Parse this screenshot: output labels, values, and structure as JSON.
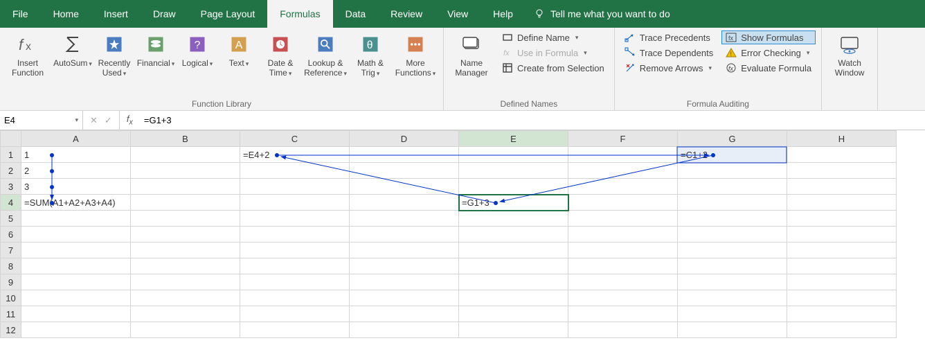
{
  "menu": {
    "tabs": [
      "File",
      "Home",
      "Insert",
      "Draw",
      "Page Layout",
      "Formulas",
      "Data",
      "Review",
      "View",
      "Help"
    ],
    "active": "Formulas",
    "tell_me": "Tell me what you want to do"
  },
  "ribbon": {
    "group_labels": {
      "funclib": "Function Library",
      "defnames": "Defined Names",
      "auditing": "Formula Auditing"
    },
    "insert_function": "Insert Function",
    "autosum": "AutoSum",
    "recently_used": "Recently Used",
    "financial": "Financial",
    "logical": "Logical",
    "text": "Text",
    "date_time": "Date & Time",
    "lookup_ref": "Lookup & Reference",
    "math_trig": "Math & Trig",
    "more_func": "More Functions",
    "name_manager": "Name Manager",
    "define_name": "Define Name",
    "use_in_formula": "Use in Formula",
    "create_from_sel": "Create from Selection",
    "trace_precedents": "Trace Precedents",
    "trace_dependents": "Trace Dependents",
    "remove_arrows": "Remove Arrows",
    "show_formulas": "Show Formulas",
    "error_checking": "Error Checking",
    "evaluate_formula": "Evaluate Formula",
    "watch_window": "Watch Window"
  },
  "formulabar": {
    "namebox": "E4",
    "formula": "=G1+3"
  },
  "grid": {
    "columns": [
      "A",
      "B",
      "C",
      "D",
      "E",
      "F",
      "G",
      "H"
    ],
    "rows": 12,
    "active_cell": "E4",
    "cells": {
      "A1": "1",
      "A2": "2",
      "A3": "3",
      "A4": "=SUM(A1+A2+A3+A4)",
      "C1": "=E4+2",
      "E4": "=G1+3",
      "G1": "=C1+2"
    }
  }
}
